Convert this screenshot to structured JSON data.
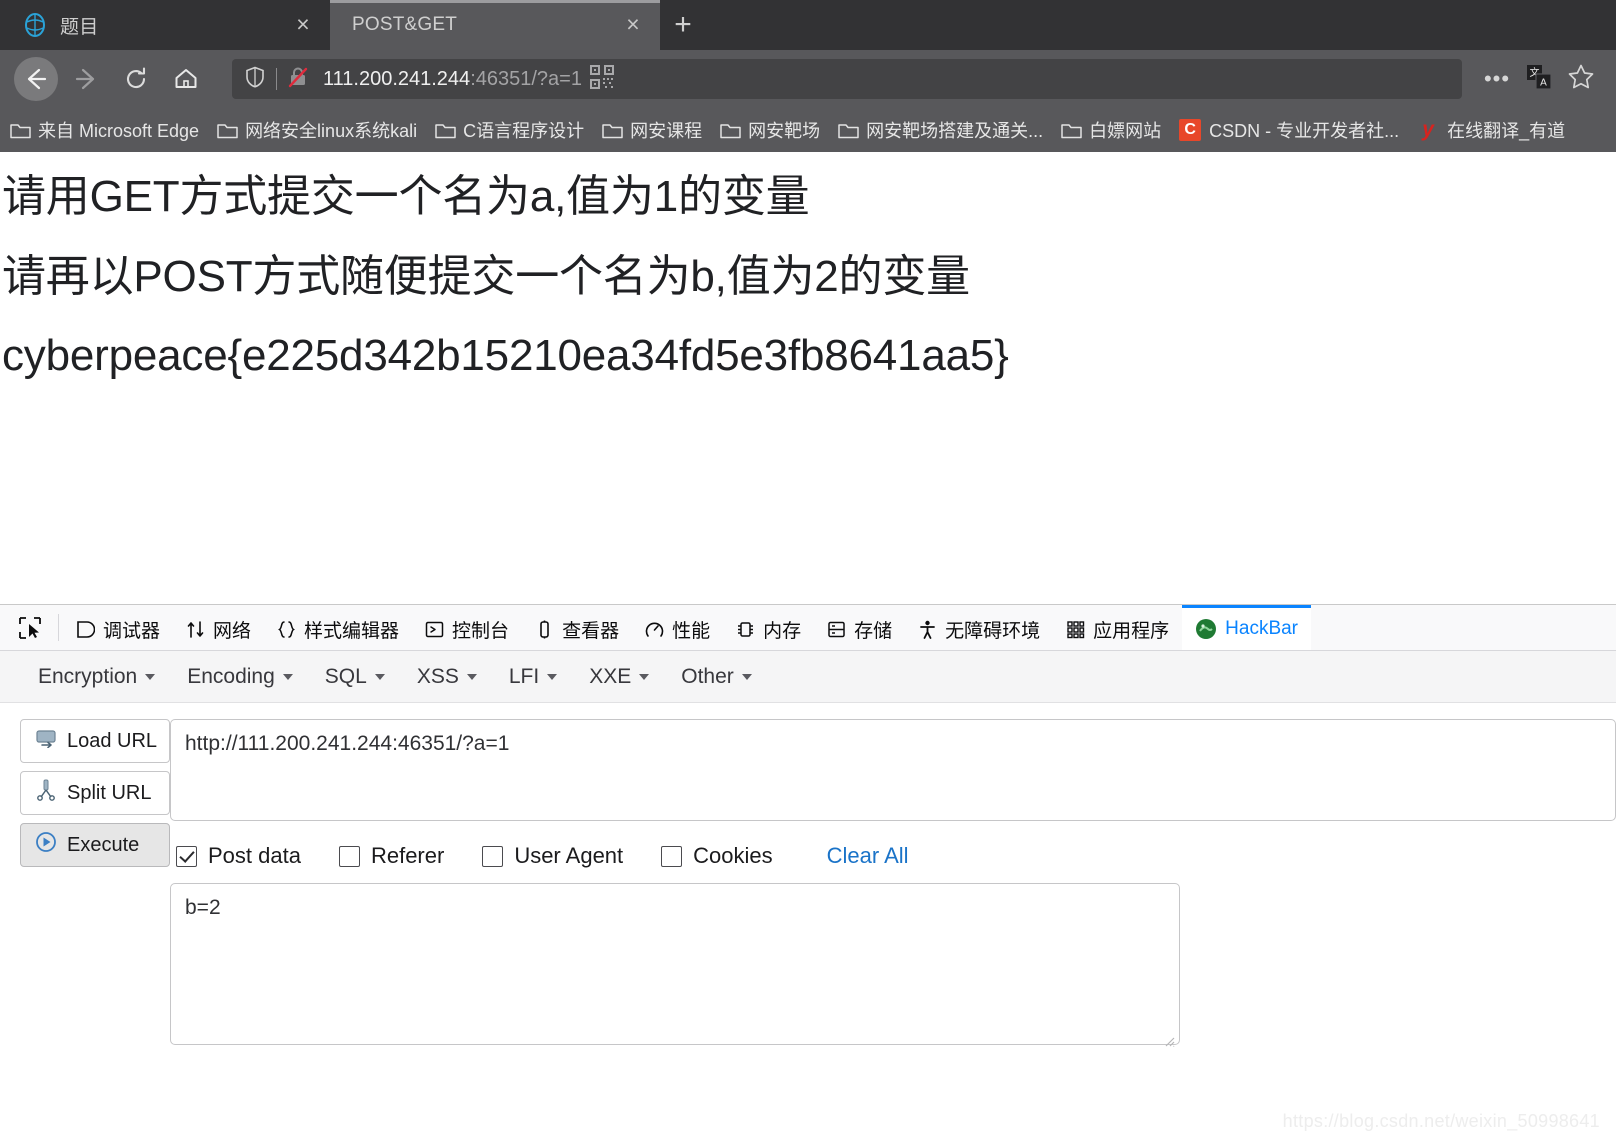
{
  "browser": {
    "tabs": [
      {
        "title": "题目",
        "active": false,
        "favicon": "globe-icon",
        "close": "×"
      },
      {
        "title": "POST&GET",
        "active": true,
        "favicon": "none",
        "close": "×"
      }
    ],
    "new_tab_label": "+",
    "nav": {
      "back": "back-arrow-icon",
      "forward": "forward-arrow-icon",
      "reload": "reload-icon",
      "home": "home-icon"
    },
    "address": {
      "host": "111.200.241.244",
      "rest": ":46351/?a=1",
      "shield_icon": "shield-icon",
      "lock_icon": "broken-lock-icon",
      "qr_icon": "qr-code-icon"
    },
    "toolbar_icons": [
      {
        "name": "more-menu-icon",
        "glyph": "•••"
      },
      {
        "name": "translate-icon",
        "glyph": "文A"
      },
      {
        "name": "bookmark-star-icon",
        "glyph": "☆"
      }
    ],
    "bookmarks": [
      {
        "label": "来自 Microsoft Edge",
        "icon": "folder-icon"
      },
      {
        "label": "网络安全linux系统kali",
        "icon": "folder-icon"
      },
      {
        "label": "C语言程序设计",
        "icon": "folder-icon"
      },
      {
        "label": "网安课程",
        "icon": "folder-icon"
      },
      {
        "label": "网安靶场",
        "icon": "folder-icon"
      },
      {
        "label": "网安靶场搭建及通关...",
        "icon": "folder-icon"
      },
      {
        "label": "白嫖网站",
        "icon": "folder-icon"
      },
      {
        "label": "CSDN - 专业开发者社...",
        "icon": "csdn-icon"
      },
      {
        "label": "在线翻译_有道",
        "icon": "youdao-icon"
      }
    ]
  },
  "page": {
    "line1": "请用GET方式提交一个名为a,值为1的变量",
    "line2": "请再以POST方式随便提交一个名为b,值为2的变量",
    "line3": "cyberpeace{e225d342b15210ea34fd5e3fb8641aa5}"
  },
  "devtools": {
    "picker_icon": "element-picker-icon",
    "tabs": [
      {
        "label": "调试器",
        "icon": "debugger-icon",
        "active": false
      },
      {
        "label": "网络",
        "icon": "network-icon",
        "active": false
      },
      {
        "label": "样式编辑器",
        "icon": "style-editor-icon",
        "active": false
      },
      {
        "label": "控制台",
        "icon": "console-icon",
        "active": false
      },
      {
        "label": "查看器",
        "icon": "inspector-icon",
        "active": false
      },
      {
        "label": "性能",
        "icon": "performance-icon",
        "active": false
      },
      {
        "label": "内存",
        "icon": "memory-icon",
        "active": false
      },
      {
        "label": "存储",
        "icon": "storage-icon",
        "active": false
      },
      {
        "label": "无障碍环境",
        "icon": "accessibility-icon",
        "active": false
      },
      {
        "label": "应用程序",
        "icon": "application-icon",
        "active": false
      },
      {
        "label": "HackBar",
        "icon": "hackbar-icon",
        "active": true
      }
    ],
    "active_tab_color": "#0a84ff"
  },
  "hackbar": {
    "menu": [
      {
        "label": "Encryption",
        "has_caret": true
      },
      {
        "label": "Encoding",
        "has_caret": true
      },
      {
        "label": "SQL",
        "has_caret": true
      },
      {
        "label": "XSS",
        "has_caret": true
      },
      {
        "label": "LFI",
        "has_caret": true
      },
      {
        "label": "XXE",
        "has_caret": true
      },
      {
        "label": "Other",
        "has_caret": true
      }
    ],
    "buttons": [
      {
        "label": "Load URL",
        "icon": "load-url-icon",
        "pressed": false
      },
      {
        "label": "Split URL",
        "icon": "split-url-icon",
        "pressed": false
      },
      {
        "label": "Execute",
        "icon": "execute-icon",
        "pressed": true
      }
    ],
    "url_value": "http://111.200.241.244:46351/?a=1",
    "checkboxes": [
      {
        "label": "Post data",
        "checked": true
      },
      {
        "label": "Referer",
        "checked": false
      },
      {
        "label": "User Agent",
        "checked": false
      },
      {
        "label": "Cookies",
        "checked": false
      }
    ],
    "clear_all_label": "Clear All",
    "post_data_value": "b=2"
  },
  "watermark": "https://blog.csdn.net/weixin_50998641"
}
